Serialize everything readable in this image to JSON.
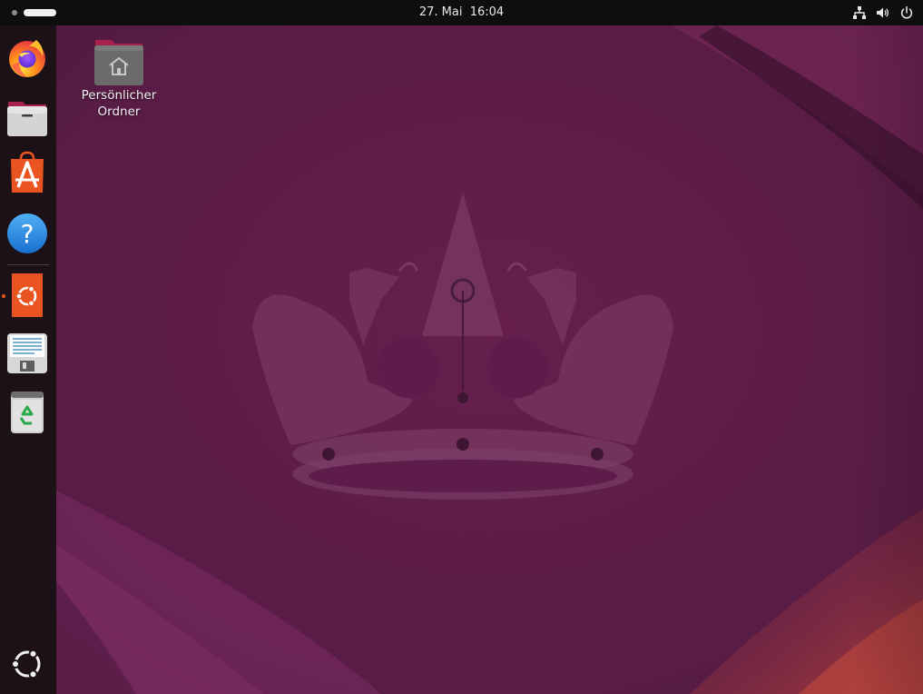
{
  "topbar": {
    "date": "27. Mai",
    "time": "16:04",
    "activities_icon": "activities-indicator-icon",
    "tray_icons": [
      "network-wired-icon",
      "volume-icon",
      "power-icon"
    ]
  },
  "dock": {
    "items": [
      {
        "name": "firefox",
        "icon": "firefox-icon",
        "running": false
      },
      {
        "name": "files",
        "icon": "files-icon",
        "running": false
      },
      {
        "name": "app-center",
        "icon": "app-center-icon",
        "running": false
      },
      {
        "name": "help",
        "icon": "help-icon",
        "running": false
      },
      {
        "name": "ubuntu-installer",
        "icon": "ubuntu-installer-icon",
        "running": true
      },
      {
        "name": "text-editor",
        "icon": "text-editor-icon",
        "running": false
      },
      {
        "name": "trash",
        "icon": "trash-icon",
        "running": false
      }
    ],
    "show_apps_icon": "ubuntu-show-apps-icon"
  },
  "desktop": {
    "icons": [
      {
        "label": "Persönlicher\nOrdner",
        "icon": "home-folder-icon"
      }
    ]
  },
  "colors": {
    "topbar_bg": "#0e0e0e",
    "dock_bg": "#1d1118",
    "wallpaper_base": "#5a1f45",
    "accent_orange": "#e95420"
  }
}
